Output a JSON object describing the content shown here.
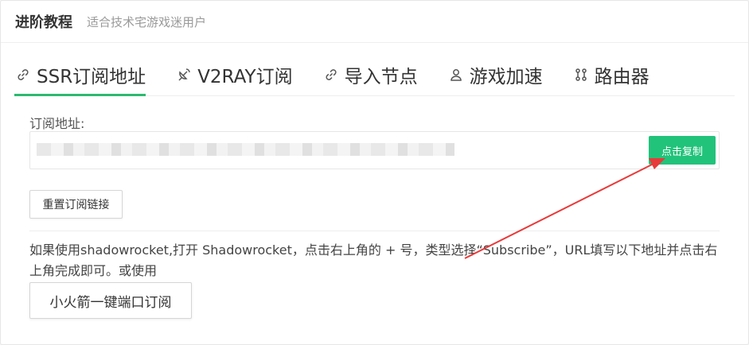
{
  "header": {
    "title": "进阶教程",
    "subtitle": "适合技术宅游戏迷用户"
  },
  "tabs": [
    {
      "label": "SSR订阅地址",
      "icon": "link-icon",
      "active": true
    },
    {
      "label": "V2RAY订阅",
      "icon": "satellite-icon",
      "active": false
    },
    {
      "label": "导入节点",
      "icon": "link-icon",
      "active": false
    },
    {
      "label": "游戏加速",
      "icon": "user-icon",
      "active": false
    },
    {
      "label": "路由器",
      "icon": "router-icon",
      "active": false
    }
  ],
  "subscription": {
    "label": "订阅地址:",
    "copy_button": "点击复制",
    "reset_button": "重置订阅链接"
  },
  "instructions": {
    "text": "如果使用shadowrocket,打开 Shadowrocket，点击右上角的 + 号，类型选择“Subscribe”，URL填写以下地址并点击右上角完成即可。或使用",
    "button": "小火箭一键端口订阅"
  },
  "colors": {
    "accent": "#2cb971",
    "copy_button": "#21c37a",
    "arrow": "#e83a3a"
  }
}
